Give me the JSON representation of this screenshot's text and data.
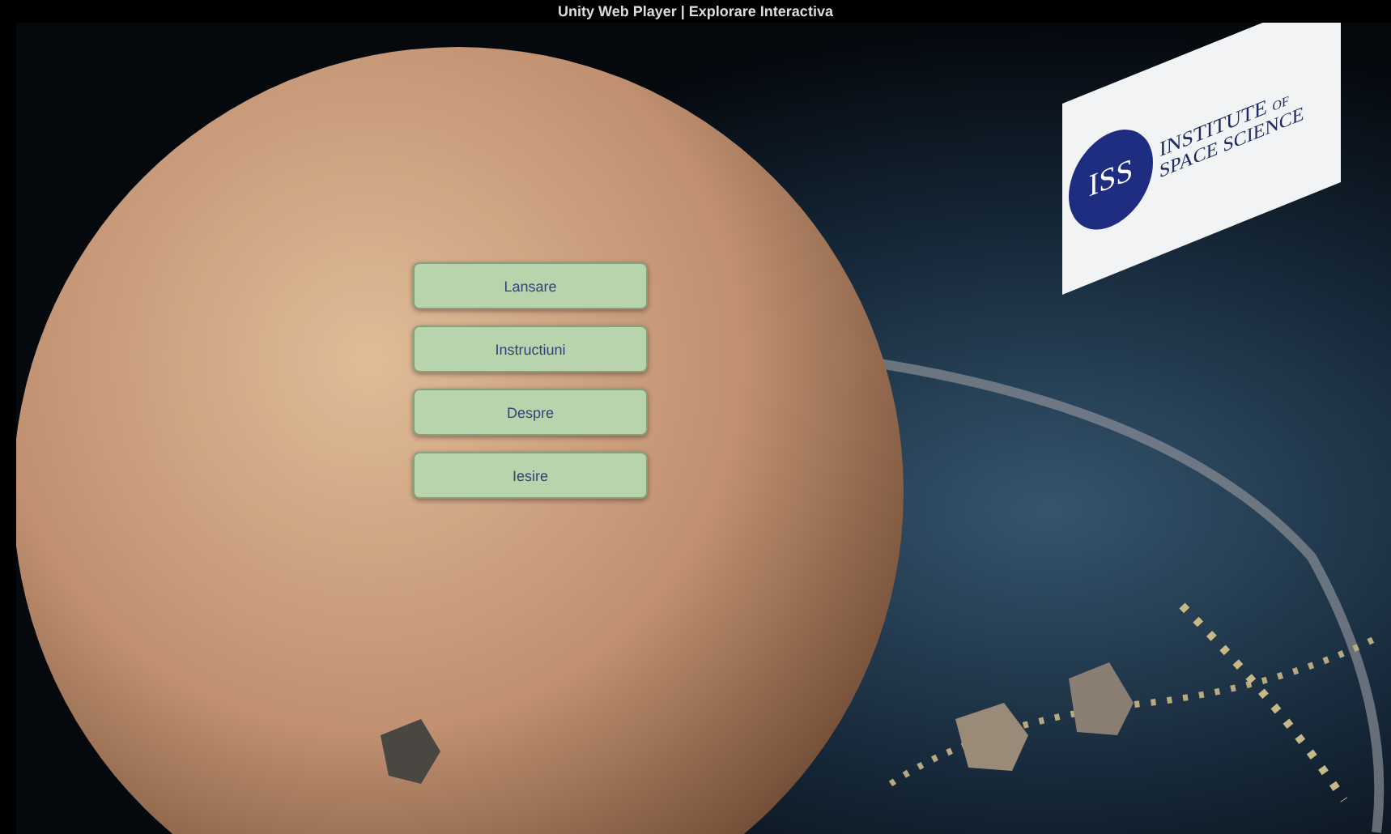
{
  "window": {
    "title": "Unity Web Player | Explorare Interactiva"
  },
  "logo": {
    "abbreviation": "ISS",
    "line_1": "INSTITUTE",
    "line_1_suffix": "OF",
    "line_2": "SPACE SCIENCE"
  },
  "menu": [
    {
      "label": "Lansare"
    },
    {
      "label": "Instructiuni"
    },
    {
      "label": "Despre"
    },
    {
      "label": "Iesire"
    }
  ]
}
